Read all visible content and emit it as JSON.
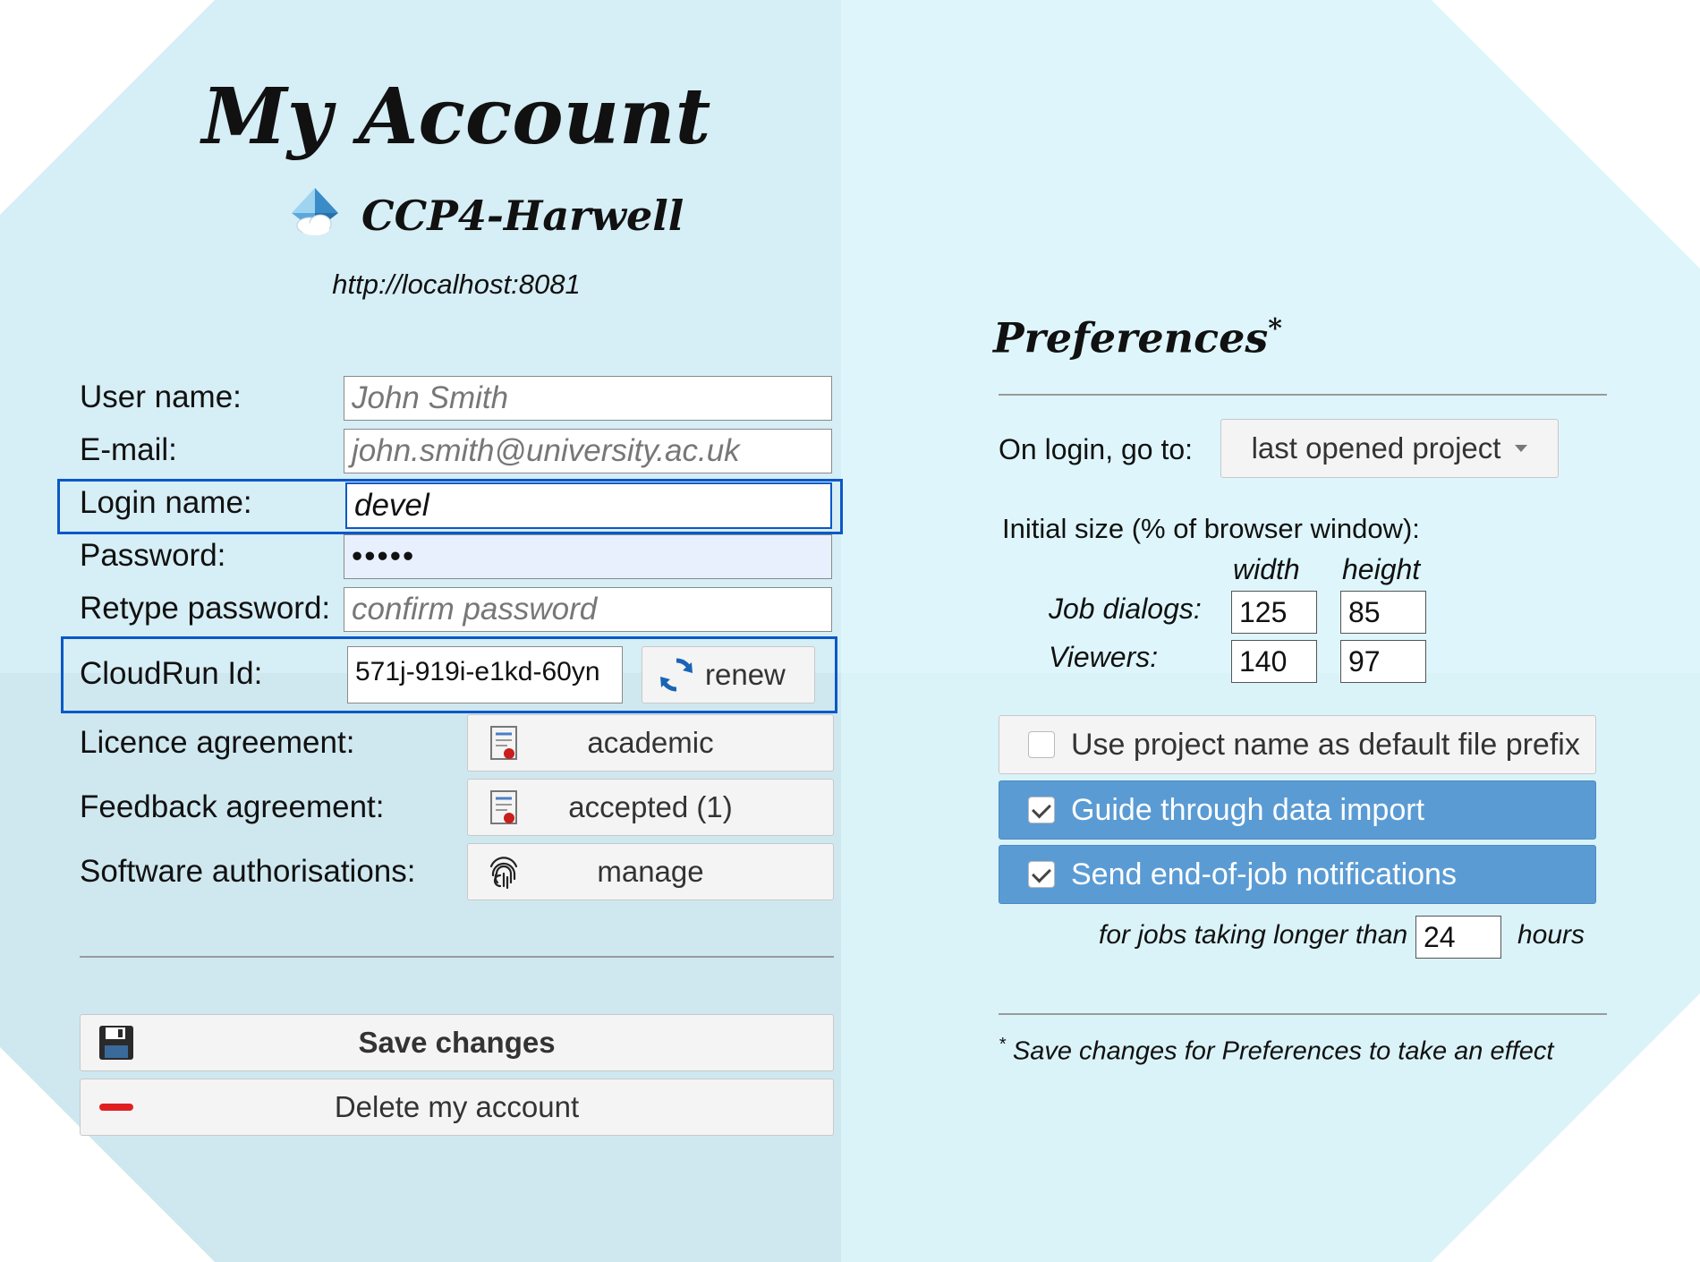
{
  "account": {
    "title": "My Account",
    "site_name": "CCP4-Harwell",
    "url": "http://localhost:8081"
  },
  "form": {
    "user_name_label": "User name:",
    "user_name_value": "John Smith",
    "email_label": "E-mail:",
    "email_value": "john.smith@university.ac.uk",
    "login_label": "Login name:",
    "login_value": "devel",
    "password_label": "Password:",
    "password_value": "•••••",
    "retype_label": "Retype password:",
    "retype_placeholder": "confirm password",
    "cloudrun_label": "CloudRun Id:",
    "cloudrun_value": "571j-919i-e1kd-60yn",
    "renew_label": "renew",
    "licence_label": "Licence agreement:",
    "licence_value": "academic",
    "feedback_label": "Feedback agreement:",
    "feedback_value": "accepted (1)",
    "software_label": "Software authorisations:",
    "software_value": "manage"
  },
  "actions": {
    "save_label": "Save changes",
    "delete_label": "Delete my account"
  },
  "preferences": {
    "title": "Preferences",
    "title_mark": "*",
    "login_goto_label": "On login, go to:",
    "login_goto_value": "last opened project",
    "initial_size_label": "Initial size (% of browser window):",
    "width_header": "width",
    "height_header": "height",
    "job_dialogs_label": "Job dialogs:",
    "job_dialogs_width": "125",
    "job_dialogs_height": "85",
    "viewers_label": "Viewers:",
    "viewers_width": "140",
    "viewers_height": "97",
    "toggle_prefix_label": "Use project name as default file prefix",
    "toggle_prefix_checked": false,
    "toggle_guide_label": "Guide through data import",
    "toggle_guide_checked": true,
    "toggle_notify_label": "Send end-of-job notifications",
    "toggle_notify_checked": true,
    "notify_prefix": "for jobs taking longer than",
    "notify_hours": "24",
    "notify_suffix": "hours",
    "footnote_mark": "*",
    "footnote": "Save changes for Preferences to take an effect"
  },
  "colors": {
    "highlight_border": "#0a58c8",
    "toggle_on": "#5a9bd4",
    "delete_icon": "#e02020"
  },
  "icons": [
    "cloud-diamond-icon",
    "refresh-icon",
    "certificate-icon",
    "fingerprint-icon",
    "floppy-disk-icon",
    "minus-icon",
    "chevron-down-icon",
    "checkbox-icon"
  ]
}
